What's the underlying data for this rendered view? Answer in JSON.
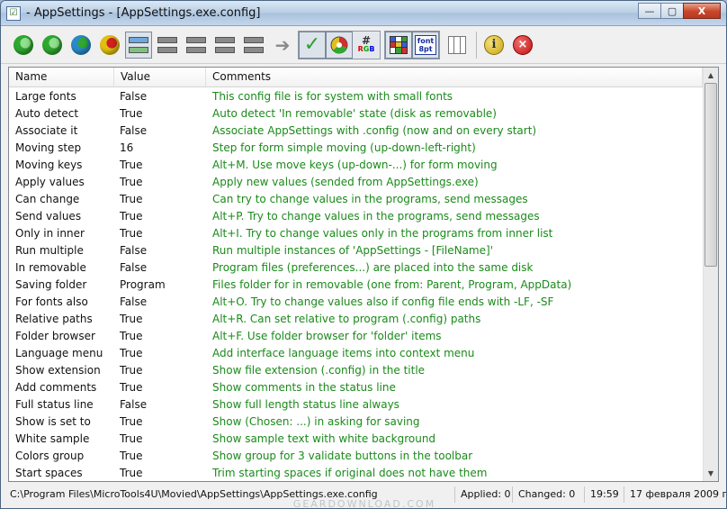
{
  "window": {
    "title": "- AppSettings - [AppSettings.exe.config]",
    "minimize": "—",
    "maximize": "▢",
    "close": "X"
  },
  "toolbar": {
    "balls": [
      "#2fa82f",
      "#2fa82f",
      "#2a8ac9",
      "#e0c010"
    ],
    "ball_accents": [
      "#8fe08f",
      "#8fe08f",
      "#2fa82f",
      "#d02020"
    ],
    "check_glyph": "✓",
    "arrow_glyph": "➔",
    "rgb_hash": "#",
    "rgb_r": "R",
    "rgb_g": "G",
    "rgb_b": "B",
    "font_line1": "font",
    "font_line2": "8pt",
    "info_glyph": "i",
    "stop_glyph": "×",
    "grid_colors": [
      "#3a5fcd",
      "#ffffff",
      "#3a9f3a",
      "#d03030",
      "#e0c030",
      "#3a5fcd",
      "#ffffff",
      "#3a9f3a",
      "#d03030"
    ]
  },
  "grid": {
    "columns": [
      "Name",
      "Value",
      "Comments"
    ],
    "rows": [
      {
        "name": "Large fonts",
        "value": "False",
        "comment": "This config file is for system with small fonts"
      },
      {
        "name": "Auto detect",
        "value": "True",
        "comment": "Auto detect 'In removable' state (disk as removable)"
      },
      {
        "name": "Associate it",
        "value": "False",
        "comment": "Associate AppSettings with .config (now and on every start)"
      },
      {
        "name": "Moving step",
        "value": "16",
        "comment": "Step for form simple moving (up-down-left-right)"
      },
      {
        "name": "Moving keys",
        "value": "True",
        "comment": "Alt+M. Use move keys (up-down-...) for form moving"
      },
      {
        "name": "Apply values",
        "value": "True",
        "comment": "Apply new values (sended from AppSettings.exe)"
      },
      {
        "name": "Can change",
        "value": "True",
        "comment": "Can try to change values in the programs, send messages"
      },
      {
        "name": "Send values",
        "value": "True",
        "comment": "Alt+P. Try to change values in the programs, send messages"
      },
      {
        "name": "Only in inner",
        "value": "True",
        "comment": "Alt+I. Try to change values only in the programs from inner list"
      },
      {
        "name": "Run multiple",
        "value": "False",
        "comment": "Run multiple instances of 'AppSettings - [FileName]'"
      },
      {
        "name": "In removable",
        "value": "False",
        "comment": "Program files (preferences...) are placed into the same disk"
      },
      {
        "name": "Saving folder",
        "value": "Program",
        "comment": "Files folder for in removable (one from: Parent, Program, AppData)"
      },
      {
        "name": "For fonts also",
        "value": "False",
        "comment": "Alt+O. Try to change values also if config file ends with -LF, -SF"
      },
      {
        "name": "Relative paths",
        "value": "True",
        "comment": "Alt+R. Can set relative to program (.config) paths"
      },
      {
        "name": "Folder browser",
        "value": "True",
        "comment": "Alt+F. Use folder browser for 'folder' items"
      },
      {
        "name": "Language menu",
        "value": "True",
        "comment": "Add interface language items into context menu"
      },
      {
        "name": "Show extension",
        "value": "True",
        "comment": "Show file extension (.config) in the title"
      },
      {
        "name": "Add comments",
        "value": "True",
        "comment": "Show comments in the status line"
      },
      {
        "name": "Full status line",
        "value": "False",
        "comment": "Show full length status line always"
      },
      {
        "name": "Show is set to",
        "value": "True",
        "comment": "Show (Chosen: ...) in asking for saving"
      },
      {
        "name": "White sample",
        "value": "True",
        "comment": "Show sample text with white background"
      },
      {
        "name": "Colors group",
        "value": "True",
        "comment": "Show group for 3 validate buttons in the toolbar"
      },
      {
        "name": "Start spaces",
        "value": "True",
        "comment": "Trim starting spaces if original does not have them"
      }
    ]
  },
  "scroll": {
    "up": "▲",
    "down": "▼"
  },
  "status": {
    "path": "C:\\Program Files\\MicroTools4U\\Movied\\AppSettings\\AppSettings.exe.config",
    "applied": "Applied: 0",
    "changed": "Changed: 0",
    "time": "19:59",
    "date": "17 февраля 2009 г."
  },
  "watermark": "GEARDOWNLOAD.COM"
}
